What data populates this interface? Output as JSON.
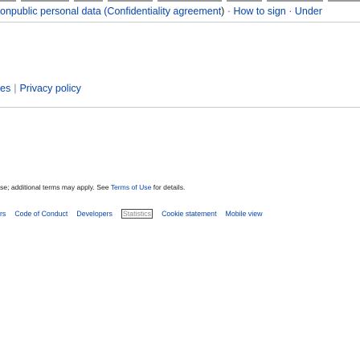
{
  "top_links": [
    {
      "text": "onpublic personal data (Confidentiality agreement",
      "sep": " · "
    },
    {
      "text": "How to sign",
      "sep": " · "
    },
    {
      "text": "Under",
      "sep": ""
    }
  ],
  "top_links_closing": ")",
  "section": {
    "prev_fragment": "es",
    "separator": "|",
    "privacy_policy": "Privacy policy"
  },
  "license": {
    "before": "se; additional terms may apply. See ",
    "terms_link": "Terms of Use",
    "after": " for details."
  },
  "footer": {
    "links": [
      {
        "id": "footer-link-prev",
        "text": "rs"
      },
      {
        "id": "footer-link-code-of-conduct",
        "text": "Code of Conduct"
      },
      {
        "id": "footer-link-developers",
        "text": "Developers"
      },
      {
        "id": "footer-link-statistics",
        "text": "Statistics",
        "boxed": true
      },
      {
        "id": "footer-link-cookie-statement",
        "text": "Cookie statement"
      },
      {
        "id": "footer-link-mobile-view",
        "text": "Mobile view"
      }
    ]
  },
  "colors": {
    "link": "#0645ad",
    "text": "#222222",
    "rule": "#c8ccd1"
  }
}
